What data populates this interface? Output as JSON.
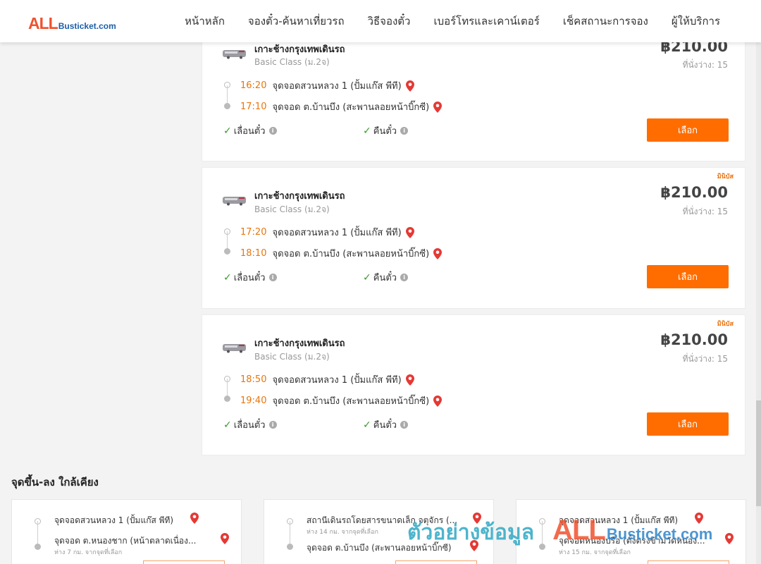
{
  "header": {
    "logo_all": "ALL",
    "logo_rest": "Busticket.com",
    "nav": [
      "หน้าหลัก",
      "จองตั๋ว-ค้นหาเที่ยวรถ",
      "วิธีจองตั๋ว",
      "เบอร์โทรและเคาน์เตอร์",
      "เช็คสถานะการจอง",
      "ผู้ให้บริการ"
    ]
  },
  "trips": [
    {
      "tag": "",
      "operator_logo": "bus-operator-logo",
      "route": "เกาะช้างกรุงเทพเดินรถ",
      "bus_class": "Basic Class (ม.2จ)",
      "price": "฿210.00",
      "seats": "ที่นั่งว่าง: 15",
      "departure_time": "16:20",
      "departure_stop": "จุดจอดสวนหลวง 1 (ปั้มแก๊ส พีที)",
      "arrival_time": "17:10",
      "arrival_stop": "จุดจอด ต.บ้านบึง (สะพานลอยหน้าบิ๊กซี)",
      "policy_postpone": "เลื่อนตั๋ว",
      "policy_refund": "คืนตั๋ว",
      "select_label": "เลือก"
    },
    {
      "tag": "มินิบัส",
      "operator_logo": "bus-operator-logo",
      "route": "เกาะช้างกรุงเทพเดินรถ",
      "bus_class": "Basic Class (ม.2จ)",
      "price": "฿210.00",
      "seats": "ที่นั่งว่าง: 15",
      "departure_time": "17:20",
      "departure_stop": "จุดจอดสวนหลวง 1 (ปั้มแก๊ส พีที)",
      "arrival_time": "18:10",
      "arrival_stop": "จุดจอด ต.บ้านบึง (สะพานลอยหน้าบิ๊กซี)",
      "policy_postpone": "เลื่อนตั๋ว",
      "policy_refund": "คืนตั๋ว",
      "select_label": "เลือก"
    },
    {
      "tag": "มินิบัส",
      "operator_logo": "bus-operator-logo",
      "route": "เกาะช้างกรุงเทพเดินรถ",
      "bus_class": "Basic Class (ม.2จ)",
      "price": "฿210.00",
      "seats": "ที่นั่งว่าง: 15",
      "departure_time": "18:50",
      "departure_stop": "จุดจอดสวนหลวง 1 (ปั้มแก๊ส พีที)",
      "arrival_time": "19:40",
      "arrival_stop": "จุดจอด ต.บ้านบึง (สะพานลอยหน้าบิ๊กซี)",
      "policy_postpone": "เลื่อนตั๋ว",
      "policy_refund": "คืนตั๋ว",
      "select_label": "เลือก"
    }
  ],
  "nearby": {
    "title": "จุดขึ้น-ลง ใกล้เคียง",
    "cards": [
      {
        "from_stop": "จุดจอดสวนหลวง 1 (ปั้มแก๊ส พีที)",
        "from_distance": "",
        "to_stop": "จุดจอด ต.หนองชาก (หน้าตลาดเนื่อง...",
        "to_distance": "ห่าง 7 กม. จากจุดที่เลือก"
      },
      {
        "from_stop": "สถานีเดินรถโดยสารขนาดเล็ก จตุจักร (...",
        "from_distance": "ห่าง 14 กม. จากจุดที่เลือก",
        "to_stop": "จุดจอด ต.บ้านบึง (สะพานลอยหน้าบิ๊กซี)",
        "to_distance": ""
      },
      {
        "from_stop": "จุดจอดสวนหลวง 1 (ปั้มแก๊ส พีที)",
        "from_distance": "",
        "to_stop": "จุดจอดหนองปรือ (ตั้งตรงข้ามวัดหนอง...",
        "to_distance": "ห่าง 15 กม. จากจุดที่เลือก"
      }
    ]
  },
  "watermark": {
    "text": "ตัวอย่างข้อมูล",
    "all": "ALL",
    "rest": "Busticket.com"
  },
  "colors": {
    "accent": "#ff6d00",
    "time": "#e8760c",
    "check": "#3a9a2a",
    "pin": "#e53935",
    "logo_red": "#f0522f",
    "logo_blue": "#1d5fa8"
  }
}
